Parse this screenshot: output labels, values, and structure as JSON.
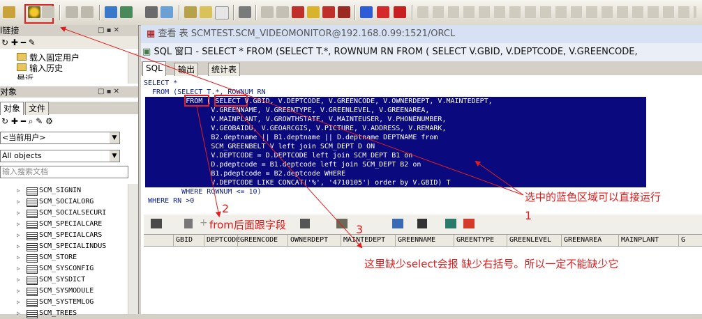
{
  "left_panel": {
    "connections_title": "l链接",
    "connections_items": [
      "载入固定用户",
      "输入历史",
      "最近"
    ],
    "objects_title": "对象",
    "objects_tabs": [
      "对象",
      "文件"
    ],
    "owner_combo": "<当前用户>",
    "filter_combo": "All objects",
    "search_placeholder": "输入搜索文档",
    "tables": [
      "SCM_SIGNIN",
      "SCM_SOCIALORG",
      "SCM_SOCIALSECURI",
      "SCM_SPECIALCARE",
      "SCM_SPECIALCARS",
      "SCM_SPECIALINDUS",
      "SCM_STORE",
      "SCM_SYSCONFIG",
      "SCM_SYSDICT",
      "SCM_SYSMODULE",
      "SCM_SYSTEMLOG",
      "SCM_TREES"
    ]
  },
  "window": {
    "view_title": "查看 表 SCMTEST.SCM_VIDEOMONITOR@192.168.0.99:1521/ORCL",
    "sql_title": "SQL 窗口 - SELECT * FROM (SELECT T.*, ROWNUM RN FROM ( SELECT V.GBID, V.DEPTCODE, V.GREENCODE, V.OWNERDEPT, ..."
  },
  "tabs": [
    "SQL",
    "输出",
    "统计表"
  ],
  "sql_lines": [
    "SELECT *",
    "  FROM (SELECT T.*, ROWNUM RN",
    "          FROM ( SELECT V.GBID, V.DEPTCODE, V.GREENCODE, V.OWNERDEPT, V.MAINTEDEPT,",
    "                V.GREENNAME, V.GREENTYPE, V.GREENLEVEL, V.GREENAREA,",
    "                V.MAINPLANT, V.GROWTHSTATE, V.MAINTEUSER, V.PHONENUMBER,",
    "                V.GEOBAIDU, V.GEOARCGIS, V.PICTURE, V.ADDRESS, V.REMARK,",
    "                B2.deptname || B1.deptname || D.deptname DEPTNAME from",
    "                SCM_GREENBELT V left join SCM_DEPT D ON",
    "                V.DEPTCODE = D.DEPTCODE left join SCM_DEPT B1 on",
    "                D.pdeptcode = B1.deptcode left join SCM_DEPT B2 on",
    "                B1.pdeptcode = B2.deptcode WHERE",
    "                V.DEPTCODE LIKE CONCAT('%', '4710105') order by V.GBID) T",
    "         WHERE ROWNUM <= 10)",
    " WHERE RN >0"
  ],
  "grid_columns": [
    "GBID",
    "DEPTCODE",
    "GREENCODE",
    "OWNERDEPT",
    "MAINTEDEPT",
    "GREENNAME",
    "GREENTYPE",
    "GREENLEVEL",
    "GREENAREA",
    "MAINPLANT",
    "G"
  ],
  "annotations": {
    "a1_text": "选中的蓝色区域可以直接运行",
    "a1_num": "1",
    "a2_text": "from后面跟字段",
    "a2_num": "2",
    "a3_text": "这里缺少select会报 缺少右括号。所以一定不能缺少它",
    "a3_num": "3"
  },
  "colors": {
    "annotation": "#e31b1b",
    "selection": "#0a0a7e",
    "sql_text": "#0a1e8c"
  }
}
